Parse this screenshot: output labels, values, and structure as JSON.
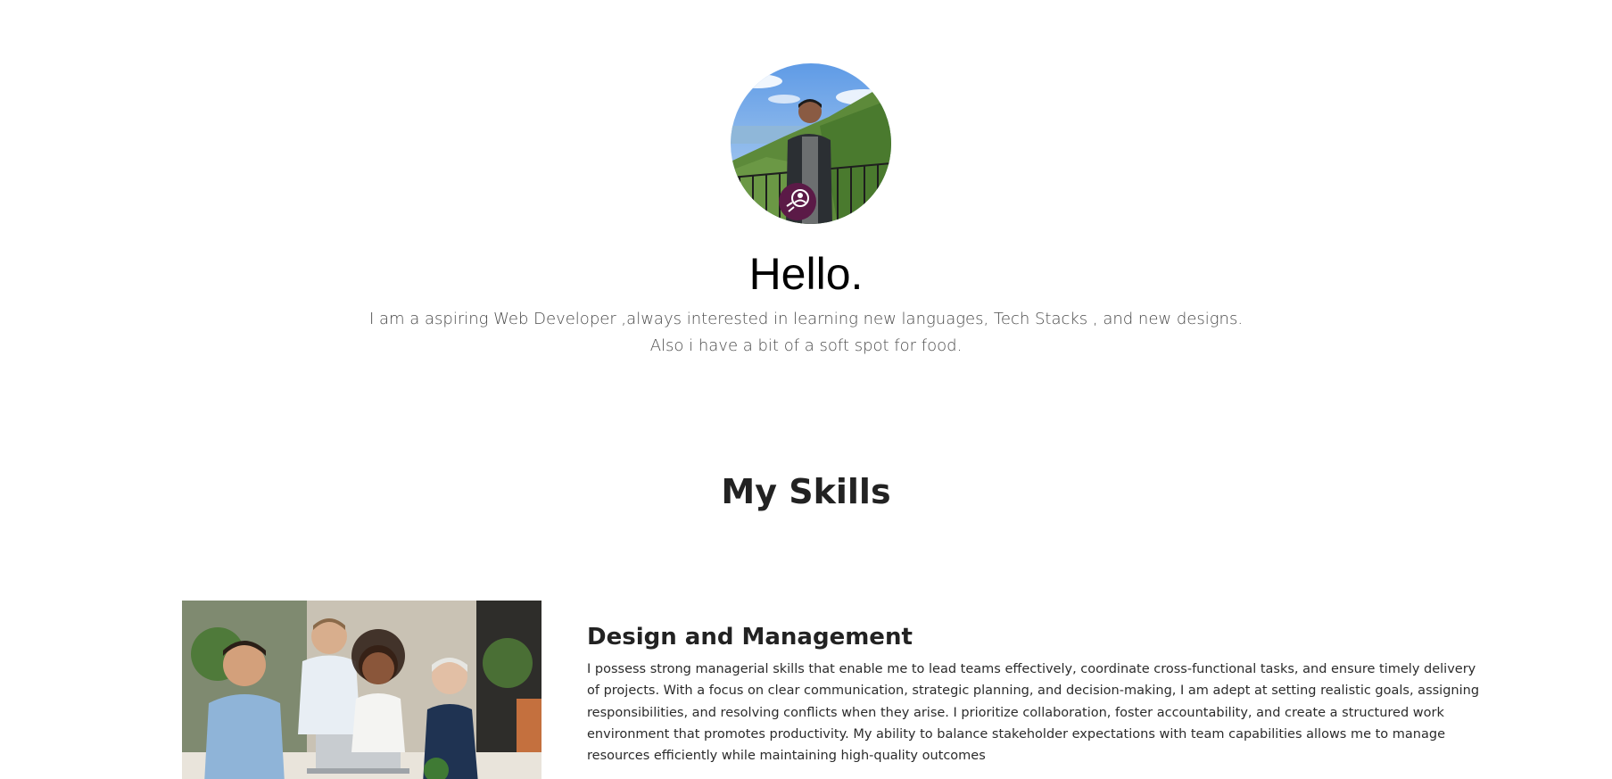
{
  "hero": {
    "avatar_icon": "profile-photo-avatar",
    "badge_icon": "rocket-user-badge-icon",
    "title": "Hello.",
    "text_line1": "I am a aspiring Web Developer ,always interested in learning new languages, Tech Stacks , and new designs.",
    "text_line2": "Also i have a bit of a soft spot for food."
  },
  "skills": {
    "title": "My Skills",
    "items": [
      {
        "image_icon": "team-meeting-photo",
        "title": "Design and Management",
        "description": "I possess strong managerial skills that enable me to lead teams effectively, coordinate cross-functional tasks, and ensure timely delivery of projects. With a focus on clear communication, strategic planning, and decision-making, I am adept at setting realistic goals, assigning responsibilities, and resolving conflicts when they arise. I prioritize collaboration, foster accountability, and create a structured work environment that promotes productivity. My ability to balance stakeholder expectations with team capabilities allows me to manage resources efficiently while maintaining high-quality outcomes"
      }
    ]
  },
  "colors": {
    "badge": "#5b1a47",
    "text": "#222222",
    "muted_text": "#4a4a4a"
  }
}
